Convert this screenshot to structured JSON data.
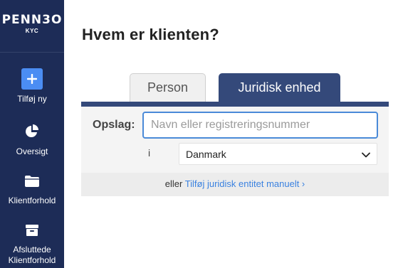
{
  "brand": {
    "name": "PENN3O",
    "sub": "KYC"
  },
  "sidebar": {
    "items": [
      {
        "label": "Tilføj ny",
        "icon": "plus-icon"
      },
      {
        "label": "Oversigt",
        "icon": "pie-chart-icon"
      },
      {
        "label": "Klientforhold",
        "icon": "folder-icon"
      },
      {
        "label_line1": "Afsluttede",
        "label_line2": "Klientforhold",
        "icon": "archive-icon"
      }
    ]
  },
  "main": {
    "title": "Hvem er klienten?",
    "tabs": [
      {
        "label": "Person",
        "active": false
      },
      {
        "label": "Juridisk enhed",
        "active": true
      }
    ],
    "lookup": {
      "label": "Opslag:",
      "placeholder": "Navn eller registreringsnummer",
      "value": ""
    },
    "country": {
      "prefix": "i",
      "selected": "Danmark"
    },
    "footer": {
      "prefix": "eller",
      "link": "Tilføj juridisk entitet manuelt ›"
    }
  },
  "colors": {
    "sidebar_bg": "#1d2c57",
    "accent": "#4b8df3",
    "tab_active": "#34497a",
    "link": "#3b82e0"
  }
}
